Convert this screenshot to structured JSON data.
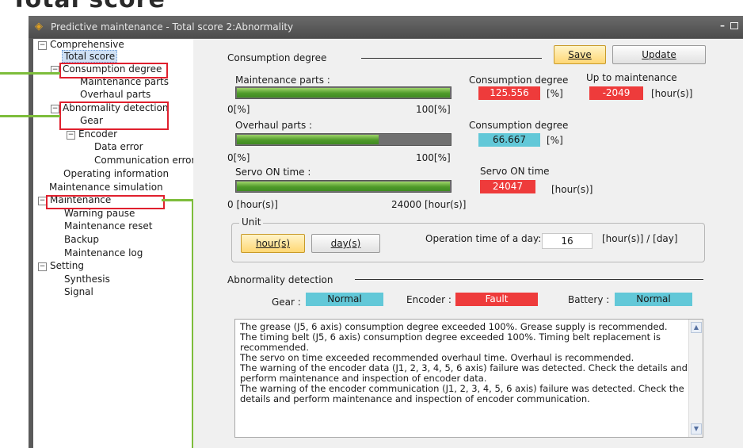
{
  "header_text": "Total score",
  "window": {
    "title": "Predictive maintenance - Total score 2:Abnormality",
    "minimize": "–"
  },
  "tree": {
    "expander_minus": "−",
    "items": [
      {
        "label": "Comprehensive"
      },
      {
        "label": "Total score"
      },
      {
        "label": "Consumption degree"
      },
      {
        "label": "Maintenance parts"
      },
      {
        "label": "Overhaul parts"
      },
      {
        "label": "Abnormality detection"
      },
      {
        "label": "Gear"
      },
      {
        "label": "Encoder"
      },
      {
        "label": "Data error"
      },
      {
        "label": "Communication error"
      },
      {
        "label": "Operating information"
      },
      {
        "label": "Maintenance simulation"
      },
      {
        "label": "Maintenance"
      },
      {
        "label": "Warning pause"
      },
      {
        "label": "Maintenance reset"
      },
      {
        "label": "Backup"
      },
      {
        "label": "Maintenance log"
      },
      {
        "label": "Setting"
      },
      {
        "label": "Synthesis"
      },
      {
        "label": "Signal"
      }
    ]
  },
  "consumption": {
    "section_title": "Consumption degree",
    "save_label": "Save",
    "update_label": "Update",
    "maintenance_parts_label": "Maintenance parts :",
    "maintenance_parts_level": 1.0,
    "axis1_min": "0[%]",
    "axis1_max": "100[%]",
    "cd_label_1": "Consumption degree",
    "cd_value_1": "125.556",
    "cd_unit_1": "[%]",
    "up_to_label": "Up to maintenance",
    "up_to_value": "-2049",
    "up_to_unit": "[hour(s)]",
    "overhaul_label": "Overhaul parts :",
    "overhaul_level": 0.667,
    "axis2_min": "0[%]",
    "axis2_max": "100[%]",
    "cd_label_2": "Consumption degree",
    "cd_value_2": "66.667",
    "cd_unit_2": "[%]",
    "servo_label": "Servo ON time :",
    "servo_level": 1.0,
    "axis3_min": "0 [hour(s)]",
    "axis3_max": "24000 [hour(s)]",
    "servo_on_label": "Servo ON time",
    "servo_on_value": "24047",
    "servo_on_unit": "[hour(s)]"
  },
  "unit": {
    "legend": "Unit",
    "hours_label": "hour(s)",
    "days_label": "day(s)",
    "op_time_label": "Operation time of a day:",
    "op_time_value": "16",
    "op_time_unit": "[hour(s)] / [day]"
  },
  "abnormality": {
    "section_title": "Abnormality detection",
    "gear_label": "Gear :",
    "gear_value": "Normal",
    "encoder_label": "Encoder :",
    "encoder_value": "Fault",
    "battery_label": "Battery :",
    "battery_value": "Normal",
    "messages": "The grease (J5, 6 axis) consumption degree exceeded 100%. Grease supply is recommended.\nThe timing belt (J5, 6 axis) consumption degree exceeded 100%. Timing belt replacement is recommended.\nThe servo on time exceeded recommended overhaul time. Overhaul is recommended.\nThe warning of the encoder data (J1, 2, 3, 4, 5, 6 axis) failure was detected. Check the details and perform maintenance and inspection of encoder data.\nThe warning of the encoder communication (J1, 2, 3, 4, 5, 6 axis) failure was detected. Check the details and perform maintenance and inspection of encoder communication."
  },
  "colors": {
    "fault": "#ee3b3b",
    "normal": "#62c8d8",
    "annotation_red": "#e0202e",
    "annotation_green": "#7dbd3b"
  }
}
